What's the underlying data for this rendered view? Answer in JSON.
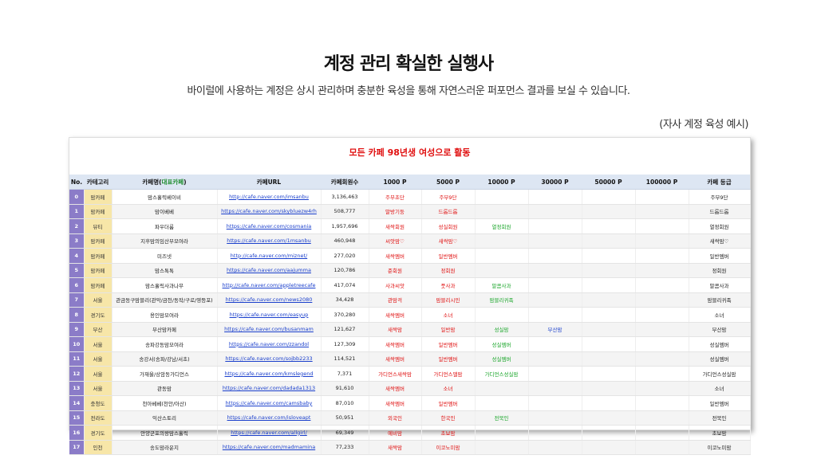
{
  "header": {
    "title": "계정 관리 확실한 실행사",
    "subtitle": "바이럴에 사용하는 계정은 상시 관리하며 충분한 육성을 통해 자연스러운 퍼포먼스 결과를 보실 수 있습니다.",
    "example_note": "(자사 계정 육성 예시)"
  },
  "banner": "모든 카페 98년생 여성으로 활동",
  "table": {
    "headers": {
      "no": "No.",
      "category": "카테고리",
      "cafe_name": "카페명(",
      "cafe_name_accent": "대표카페",
      "cafe_name_close": ")",
      "url": "카페URL",
      "members": "카페회원수",
      "p1000": "1000 P",
      "p5000": "5000 P",
      "p10000": "10000 P",
      "p30000": "30000 P",
      "p50000": "50000 P",
      "p100000": "100000 P",
      "grade": "카페 등급"
    },
    "rows": [
      {
        "no": "0",
        "cat": "맘카페",
        "name": "맘스홀릭베이비",
        "url": "http://cafe.naver.com/imsanbu",
        "members": "3,136,463",
        "p1000": "주부초단",
        "p5000": "주부9단",
        "p10000": "",
        "p30000": "",
        "p50000": "",
        "p100000": "",
        "grade": "주부9단"
      },
      {
        "no": "1",
        "cat": "맘카페",
        "name": "맘이베베",
        "url": "https://cafe.naver.com/skybluezw4rh",
        "members": "508,777",
        "p1000": "말방기둥",
        "p5000": "드롭드롭",
        "p10000": "",
        "p30000": "",
        "p50000": "",
        "p100000": "",
        "grade": "드롭드롭"
      },
      {
        "no": "2",
        "cat": "뷰티",
        "name": "파우더룸",
        "url": "https://cafe.naver.com/cosmania",
        "members": "1,957,696",
        "p1000": "새싹회원",
        "p5000": "성실회원",
        "p10000": "열정회원",
        "p30000": "",
        "p50000": "",
        "p100000": "",
        "grade": "열정회원"
      },
      {
        "no": "3",
        "cat": "맘카페",
        "name": "지후맘의임산부모여라",
        "url": "https://cafe.naver.com/1msanbu",
        "members": "460,948",
        "p1000": "씨앗맘♡",
        "p5000": "새싹맘♡",
        "p10000": "",
        "p30000": "",
        "p50000": "",
        "p100000": "",
        "grade": "새싹맘♡"
      },
      {
        "no": "4",
        "cat": "맘카페",
        "name": "미즈넷",
        "url": "http://cafe.naver.com/miznet/",
        "members": "277,020",
        "p1000": "새싹멤버",
        "p5000": "일반멤버",
        "p10000": "",
        "p30000": "",
        "p50000": "",
        "p100000": "",
        "grade": "일반멤버"
      },
      {
        "no": "5",
        "cat": "맘카페",
        "name": "맘스톡톡",
        "url": "https://cafe.naver.com/aajumma",
        "members": "120,786",
        "p1000": "준회원",
        "p5000": "정회원",
        "p10000": "",
        "p30000": "",
        "p50000": "",
        "p100000": "",
        "grade": "정회원"
      },
      {
        "no": "6",
        "cat": "맘카페",
        "name": "맘스홀릭사과나무",
        "url": "http://cafe.naver.com/appletreecafe",
        "members": "417,074",
        "p1000": "사과씨앗",
        "p5000": "풋사과",
        "p10000": "말콤사과",
        "p30000": "",
        "p50000": "",
        "p100000": "",
        "grade": "말콤사과"
      },
      {
        "no": "7",
        "cat": "서울",
        "name": "관금동구맘블리(관악/금천/동작/구로/영등포)",
        "url": "https://cafe.naver.com/news2080",
        "members": "34,428",
        "p1000": "관맘걱",
        "p5000": "맘블리시민",
        "p10000": "맘블리귀족",
        "p30000": "",
        "p50000": "",
        "p100000": "",
        "grade": "맘블리귀족"
      },
      {
        "no": "8",
        "cat": "경기도",
        "name": "용인맘모여라",
        "url": "https://cafe.naver.com/easyup",
        "members": "370,280",
        "p1000": "새싹멤버",
        "p5000": "소녀",
        "p10000": "",
        "p30000": "",
        "p50000": "",
        "p100000": "",
        "grade": "소녀"
      },
      {
        "no": "9",
        "cat": "부산",
        "name": "부산맘카페",
        "url": "https://cafe.naver.com/busanmam",
        "members": "121,627",
        "p1000": "새싹맘",
        "p5000": "일반맘",
        "p10000": "성실맘",
        "p30000": "부산맘",
        "p50000": "",
        "p100000": "",
        "grade": "부산맘"
      },
      {
        "no": "10",
        "cat": "서울",
        "name": "송파강동맘모여라",
        "url": "https://cafe.naver.com/zzandol",
        "members": "127,309",
        "p1000": "새싹멤버",
        "p5000": "일반멤버",
        "p10000": "성실멤버",
        "p30000": "",
        "p50000": "",
        "p100000": "",
        "grade": "성실멤버"
      },
      {
        "no": "11",
        "cat": "서울",
        "name": "송강서(송파/강남/서초)",
        "url": "https://cafe.naver.com/sojbb2233",
        "members": "114,521",
        "p1000": "새싹멤버",
        "p5000": "일반멤버",
        "p10000": "성실멤버",
        "p30000": "",
        "p50000": "",
        "p100000": "",
        "grade": "성실멤버"
      },
      {
        "no": "12",
        "cat": "서울",
        "name": "가재울/상암동가디언스",
        "url": "https://cafe.naver.com/kmslegend",
        "members": "7,371",
        "p1000": "가디언스새싹맘",
        "p5000": "가디언스맬맘",
        "p10000": "가디언스성실맘",
        "p30000": "",
        "p50000": "",
        "p100000": "",
        "grade": "가디언스성실맘"
      },
      {
        "no": "13",
        "cat": "서울",
        "name": "관동맘",
        "url": "https://cafe.naver.com/dadada1313",
        "members": "91,610",
        "p1000": "새싹멤버",
        "p5000": "소녀",
        "p10000": "",
        "p30000": "",
        "p50000": "",
        "p100000": "",
        "grade": "소녀"
      },
      {
        "no": "14",
        "cat": "충청도",
        "name": "천아베베(천안/아산)",
        "url": "https://cafe.naver.com/camsbaby",
        "members": "87,010",
        "p1000": "새싹멤버",
        "p5000": "일반멤버",
        "p10000": "",
        "p30000": "",
        "p50000": "",
        "p100000": "",
        "grade": "일반멤버"
      },
      {
        "no": "15",
        "cat": "전라도",
        "name": "익산스토리",
        "url": "https://cafe.naver.com/isloveapt",
        "members": "50,951",
        "p1000": "외국인",
        "p5000": "한국인",
        "p10000": "전북인",
        "p30000": "",
        "p50000": "",
        "p100000": "",
        "grade": "전북인"
      },
      {
        "no": "16",
        "cat": "경기도",
        "name": "안양군포의왕맘스홀릭",
        "url": "https://cafe.naver.com/allgirl/",
        "members": "69,349",
        "p1000": "예비맘",
        "p5000": "초보맘",
        "p10000": "",
        "p30000": "",
        "p50000": "",
        "p100000": "",
        "grade": "초보맘"
      },
      {
        "no": "17",
        "cat": "인천",
        "name": "송도맘라운지",
        "url": "https://cafe.naver.com/madmamina",
        "members": "77,233",
        "p1000": "새싹맘",
        "p5000": "이코노미맘",
        "p10000": "",
        "p30000": "",
        "p50000": "",
        "p100000": "",
        "grade": "이코노미맘"
      }
    ]
  }
}
